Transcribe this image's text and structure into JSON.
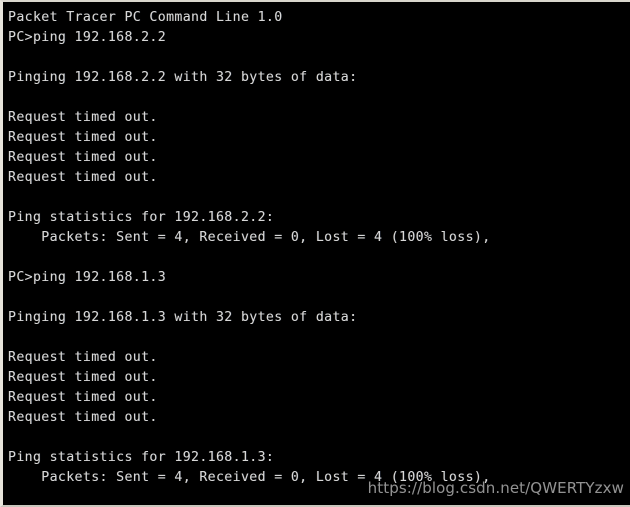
{
  "window": {
    "title": "Packet Tracer PC Command Line 1.0",
    "background_color": "#000000",
    "text_color": "#d8d8d8",
    "border_color": "#e8e5dc"
  },
  "terminal": {
    "prompt": "PC>",
    "lines": [
      "Packet Tracer PC Command Line 1.0",
      "PC>ping 192.168.2.2",
      "",
      "Pinging 192.168.2.2 with 32 bytes of data:",
      "",
      "Request timed out.",
      "Request timed out.",
      "Request timed out.",
      "Request timed out.",
      "",
      "Ping statistics for 192.168.2.2:",
      "    Packets: Sent = 4, Received = 0, Lost = 4 (100% loss),",
      "",
      "PC>ping 192.168.1.3",
      "",
      "Pinging 192.168.1.3 with 32 bytes of data:",
      "",
      "Request timed out.",
      "Request timed out.",
      "Request timed out.",
      "Request timed out.",
      "",
      "Ping statistics for 192.168.1.3:",
      "    Packets: Sent = 4, Received = 0, Lost = 4 (100% loss),"
    ],
    "commands": [
      "ping 192.168.2.2",
      "ping 192.168.1.3"
    ],
    "ping_sessions": [
      {
        "target": "192.168.2.2",
        "payload_bytes": 32,
        "replies": [
          "Request timed out.",
          "Request timed out.",
          "Request timed out.",
          "Request timed out."
        ],
        "statistics": {
          "header": "Ping statistics for 192.168.2.2:",
          "sent": 4,
          "received": 0,
          "lost": 4,
          "loss_percent": "100%"
        }
      },
      {
        "target": "192.168.1.3",
        "payload_bytes": 32,
        "replies": [
          "Request timed out.",
          "Request timed out.",
          "Request timed out.",
          "Request timed out."
        ],
        "statistics": {
          "header": "Ping statistics for 192.168.1.3:",
          "sent": 4,
          "received": 0,
          "lost": 4,
          "loss_percent": "100%"
        }
      }
    ]
  },
  "watermark": {
    "text": "https://blog.csdn.net/QWERTYzxw"
  }
}
